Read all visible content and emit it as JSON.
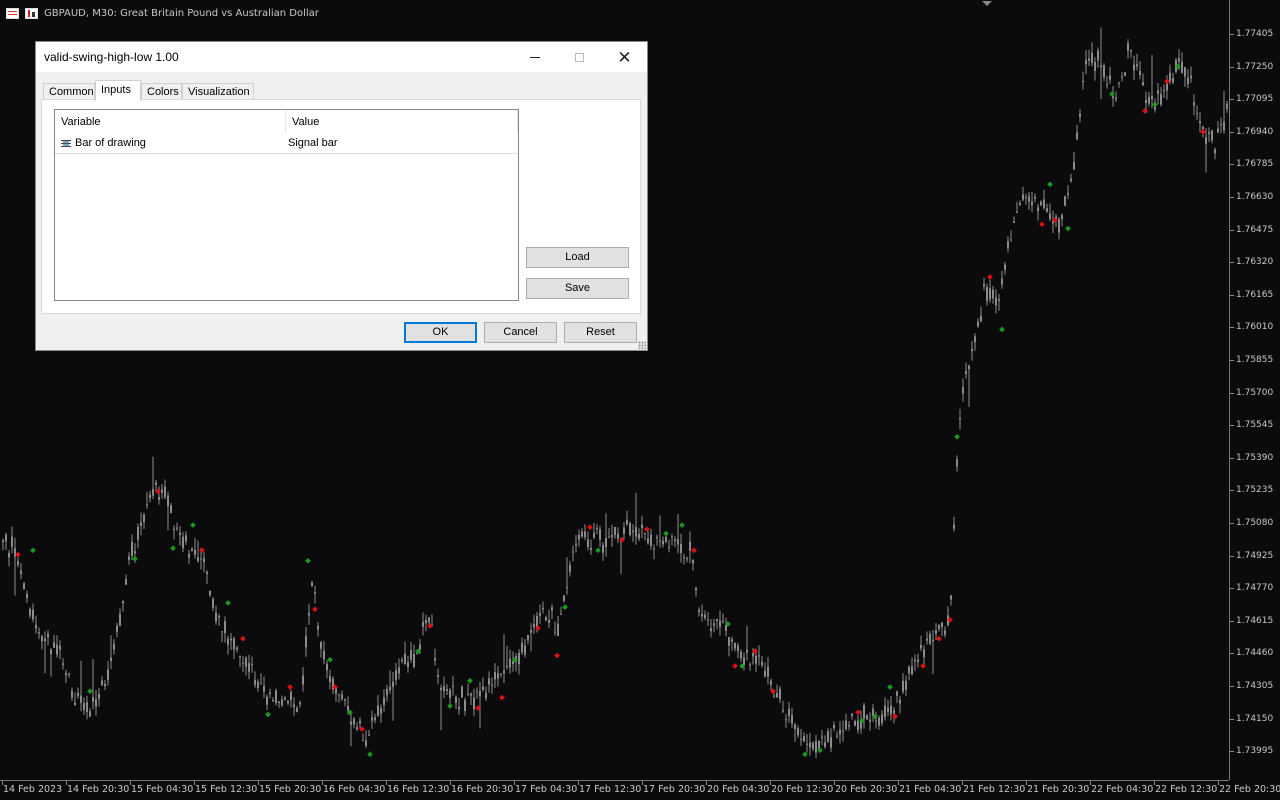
{
  "chart": {
    "title": "GBPAUD, M30:  Great Britain Pound vs Australian Dollar",
    "price_labels": [
      "1.77405",
      "1.77250",
      "1.77095",
      "1.76940",
      "1.76785",
      "1.76630",
      "1.76475",
      "1.76320",
      "1.76165",
      "1.76010",
      "1.75855",
      "1.75700",
      "1.75545",
      "1.75390",
      "1.75235",
      "1.75080",
      "1.74925",
      "1.74770",
      "1.74615",
      "1.74460",
      "1.74305",
      "1.74150",
      "1.73995"
    ],
    "time_labels": [
      "14 Feb 2023",
      "14 Feb 20:30",
      "15 Feb 04:30",
      "15 Feb 12:30",
      "15 Feb 20:30",
      "16 Feb 04:30",
      "16 Feb 12:30",
      "16 Feb 20:30",
      "17 Feb 04:30",
      "17 Feb 12:30",
      "17 Feb 20:30",
      "20 Feb 04:30",
      "20 Feb 12:30",
      "20 Feb 20:30",
      "21 Feb 04:30",
      "21 Feb 12:30",
      "21 Feb 20:30",
      "22 Feb 04:30",
      "22 Feb 12:30",
      "22 Feb 20:30"
    ],
    "colors": {
      "background": "#0b0b0e",
      "candle": "#8c8c8c",
      "swing_high": "#e01010",
      "swing_low": "#1a9a1a"
    },
    "price_path": [
      [
        0,
        1.75
      ],
      [
        15,
        1.7495
      ],
      [
        22,
        1.748
      ],
      [
        40,
        1.7455
      ],
      [
        60,
        1.7445
      ],
      [
        75,
        1.7425
      ],
      [
        90,
        1.742
      ],
      [
        110,
        1.744
      ],
      [
        130,
        1.749
      ],
      [
        150,
        1.752
      ],
      [
        165,
        1.7525
      ],
      [
        178,
        1.75
      ],
      [
        200,
        1.7495
      ],
      [
        215,
        1.7465
      ],
      [
        240,
        1.7445
      ],
      [
        265,
        1.7425
      ],
      [
        285,
        1.7425
      ],
      [
        300,
        1.742
      ],
      [
        312,
        1.748
      ],
      [
        325,
        1.744
      ],
      [
        345,
        1.742
      ],
      [
        365,
        1.7405
      ],
      [
        380,
        1.742
      ],
      [
        400,
        1.744
      ],
      [
        415,
        1.7445
      ],
      [
        430,
        1.7465
      ],
      [
        440,
        1.7425
      ],
      [
        460,
        1.7425
      ],
      [
        480,
        1.7425
      ],
      [
        500,
        1.7435
      ],
      [
        520,
        1.7445
      ],
      [
        540,
        1.7465
      ],
      [
        560,
        1.746
      ],
      [
        575,
        1.75
      ],
      [
        590,
        1.75
      ],
      [
        610,
        1.75
      ],
      [
        630,
        1.7505
      ],
      [
        650,
        1.75
      ],
      [
        670,
        1.75
      ],
      [
        690,
        1.7495
      ],
      [
        700,
        1.7465
      ],
      [
        720,
        1.746
      ],
      [
        740,
        1.7445
      ],
      [
        760,
        1.744
      ],
      [
        780,
        1.7425
      ],
      [
        800,
        1.7405
      ],
      [
        820,
        1.74
      ],
      [
        840,
        1.741
      ],
      [
        860,
        1.7415
      ],
      [
        880,
        1.7415
      ],
      [
        900,
        1.7425
      ],
      [
        920,
        1.7445
      ],
      [
        940,
        1.746
      ],
      [
        950,
        1.746
      ],
      [
        958,
        1.755
      ],
      [
        965,
        1.7575
      ],
      [
        975,
        1.7595
      ],
      [
        985,
        1.762
      ],
      [
        1000,
        1.7615
      ],
      [
        1010,
        1.7645
      ],
      [
        1020,
        1.766
      ],
      [
        1040,
        1.766
      ],
      [
        1060,
        1.765
      ],
      [
        1075,
        1.768
      ],
      [
        1085,
        1.7725
      ],
      [
        1100,
        1.773
      ],
      [
        1115,
        1.771
      ],
      [
        1130,
        1.7735
      ],
      [
        1145,
        1.771
      ],
      [
        1160,
        1.771
      ],
      [
        1175,
        1.7725
      ],
      [
        1190,
        1.772
      ],
      [
        1200,
        1.7695
      ],
      [
        1215,
        1.769
      ],
      [
        1228,
        1.7705
      ]
    ],
    "swing_highs": [
      [
        18,
        1.7493
      ],
      [
        158,
        1.7523
      ],
      [
        202,
        1.7495
      ],
      [
        243,
        1.7453
      ],
      [
        290,
        1.743
      ],
      [
        315,
        1.7467
      ],
      [
        335,
        1.743
      ],
      [
        362,
        1.741
      ],
      [
        430,
        1.7459
      ],
      [
        478,
        1.742
      ],
      [
        502,
        1.7425
      ],
      [
        538,
        1.7458
      ],
      [
        557,
        1.7445
      ],
      [
        590,
        1.7506
      ],
      [
        622,
        1.75
      ],
      [
        647,
        1.7505
      ],
      [
        694,
        1.7495
      ],
      [
        735,
        1.744
      ],
      [
        755,
        1.7447
      ],
      [
        773,
        1.7428
      ],
      [
        858,
        1.7418
      ],
      [
        895,
        1.7416
      ],
      [
        923,
        1.744
      ],
      [
        939,
        1.7453
      ],
      [
        950,
        1.7462
      ],
      [
        990,
        1.7625
      ],
      [
        1042,
        1.765
      ],
      [
        1055,
        1.7652
      ],
      [
        1145,
        1.7704
      ],
      [
        1167,
        1.7718
      ],
      [
        1203,
        1.7694
      ]
    ],
    "swing_lows": [
      [
        33,
        1.7495
      ],
      [
        90,
        1.7428
      ],
      [
        135,
        1.7491
      ],
      [
        173,
        1.7496
      ],
      [
        193,
        1.7507
      ],
      [
        228,
        1.747
      ],
      [
        268,
        1.7417
      ],
      [
        308,
        1.749
      ],
      [
        330,
        1.7443
      ],
      [
        350,
        1.7418
      ],
      [
        370,
        1.7398
      ],
      [
        418,
        1.7447
      ],
      [
        450,
        1.7421
      ],
      [
        470,
        1.7433
      ],
      [
        515,
        1.7443
      ],
      [
        565,
        1.7468
      ],
      [
        598,
        1.7495
      ],
      [
        666,
        1.7503
      ],
      [
        682,
        1.7507
      ],
      [
        728,
        1.746
      ],
      [
        742,
        1.744
      ],
      [
        805,
        1.7398
      ],
      [
        820,
        1.74
      ],
      [
        862,
        1.7414
      ],
      [
        875,
        1.7416
      ],
      [
        890,
        1.743
      ],
      [
        957,
        1.7549
      ],
      [
        1002,
        1.76
      ],
      [
        1050,
        1.7669
      ],
      [
        1068,
        1.7648
      ],
      [
        1112,
        1.7712
      ],
      [
        1155,
        1.7707
      ],
      [
        1178,
        1.7725
      ]
    ]
  },
  "dialog": {
    "title": "valid-swing-high-low 1.00",
    "tabs": [
      "Common",
      "Inputs",
      "Colors",
      "Visualization"
    ],
    "active_tab": "Inputs",
    "grid": {
      "headers": {
        "variable": "Variable",
        "value": "Value"
      },
      "rows": [
        {
          "variable": "Bar of drawing",
          "value": "Signal bar",
          "icon": "list-icon"
        }
      ]
    },
    "buttons": {
      "load": "Load",
      "save": "Save",
      "ok": "OK",
      "cancel": "Cancel",
      "reset": "Reset"
    },
    "window_controls": {
      "close": "✕"
    }
  }
}
